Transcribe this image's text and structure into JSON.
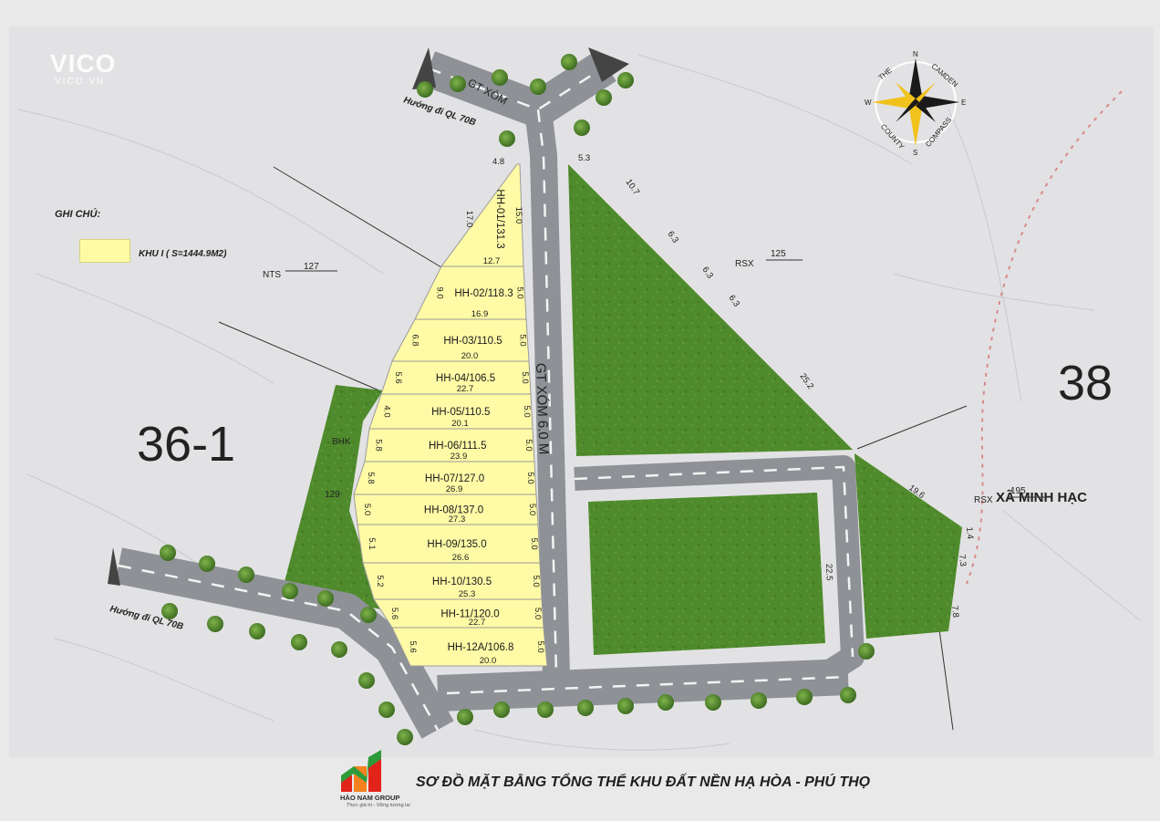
{
  "watermark": {
    "brand": "VICO",
    "site": "VICO.VN"
  },
  "legend": {
    "title": "GHI CHÚ:",
    "item_text": "KHU I ( S=1444.9M2)",
    "item_color": "#fffaa6"
  },
  "area_labels": {
    "nts": "NTS",
    "nts_num": "127",
    "rsx1": "RSX",
    "rsx1_num": "125",
    "rsx2": "RSX",
    "rsx2_num": "195",
    "bhk": "BHK",
    "bhk_num": "129",
    "bg_num_1": "38",
    "bg_num_2": "36-1",
    "bg_place": "XÃ MINH HẠC"
  },
  "roads": {
    "main": "GT XÓM 6.0 M",
    "top": "GT XÓM",
    "dir_top": "Hướng đi QL 70B",
    "dir_left": "Hướng đi QL 70B"
  },
  "compass": {
    "n": "N",
    "s": "S",
    "e": "E",
    "w": "W",
    "ring_left": "THE",
    "ring_top": "CAMDEN",
    "ring_bottom_left": "COUNTY",
    "ring_bottom_right": "COMPASS"
  },
  "plots": [
    {
      "id": "HH-01/131.3",
      "left": "17.0",
      "right": "15.0",
      "bottom": "12.7"
    },
    {
      "id": "HH-02/118.3",
      "left": "9.0",
      "right": "5.0",
      "bottom": "16.9"
    },
    {
      "id": "HH-03/110.5",
      "left": "6.8",
      "right": "5.0",
      "bottom": "20.0"
    },
    {
      "id": "HH-04/106.5",
      "left": "5.6",
      "right": "5.0",
      "bottom": "22.7"
    },
    {
      "id": "HH-05/110.5",
      "left": "4.0",
      "right": "5.0",
      "bottom": "20.1"
    },
    {
      "id": "HH-06/111.5",
      "left": "5.8",
      "right": "5.0",
      "bottom": "23.9"
    },
    {
      "id": "HH-07/127.0",
      "left": "5.8",
      "right": "5.0",
      "bottom": "26.9"
    },
    {
      "id": "HH-08/137.0",
      "left": "5.0",
      "right": "5.0",
      "bottom": "27.3"
    },
    {
      "id": "HH-09/135.0",
      "left": "5.1",
      "right": "5.0",
      "bottom": "26.6"
    },
    {
      "id": "HH-10/130.5",
      "left": "5.2",
      "right": "5.0",
      "bottom": "25.3"
    },
    {
      "id": "HH-11/120.0",
      "left": "5.6",
      "right": "5.0",
      "bottom": "22.7"
    },
    {
      "id": "HH-12A/106.8",
      "left": "5.6",
      "right": "5.0",
      "bottom": "20.0"
    }
  ],
  "top_dim": "4.8",
  "green_dims": {
    "d1": "5.3",
    "d2": "10.7",
    "d3": "6.3",
    "d4": "6.3",
    "d5": "6.3",
    "d6": "25.2",
    "d7": "19.6",
    "d8": "1.4",
    "d9": "7.3",
    "d10": "7.8",
    "d11": "22.5"
  },
  "colors": {
    "plot": "#fffaa6",
    "green": "#4f8a2c",
    "road": "#8e9196",
    "bg": "#e9e9ea"
  },
  "company": {
    "name": "HÀO NAM GROUP",
    "tagline": "Thực giá trị - Vững tương lai"
  },
  "title": "SƠ ĐỒ MẶT BẰNG TỔNG THỂ KHU ĐẤT NỀN HẠ HÒA - PHÚ THỌ"
}
